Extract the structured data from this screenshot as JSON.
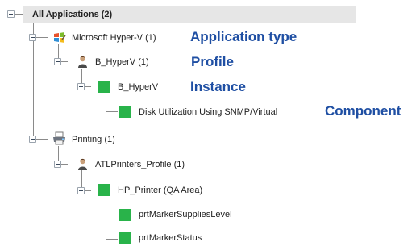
{
  "tree": {
    "root_label": "All Applications (2)",
    "app_hyperv_label": "Microsoft Hyper-V (1)",
    "profile_hyperv_label": "B_HyperV (1)",
    "instance_hyperv_label": "B_HyperV",
    "component_disk_label": "Disk Utilization Using SNMP/Virtual",
    "app_printing_label": "Printing (1)",
    "profile_printers_label": "ATLPrinters_Profile (1)",
    "instance_printer_label": "HP_Printer (QA Area)",
    "component_supplies_label": "prtMarkerSuppliesLevel",
    "component_status_label": "prtMarkerStatus"
  },
  "callouts": {
    "application_type": "Application type",
    "profile": "Profile",
    "instance": "Instance",
    "component": "Component"
  },
  "colors": {
    "callout_text": "#1f4fa3",
    "instance_green": "#29b34a",
    "root_highlight": "#e6e6e6"
  },
  "icons": {
    "hyperv": "windows-flag-icon",
    "profile": "person-icon",
    "printing": "printer-icon",
    "instance": "green-square-icon"
  }
}
